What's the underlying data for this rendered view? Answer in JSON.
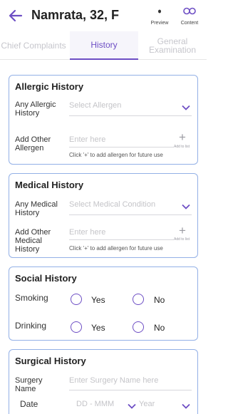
{
  "header": {
    "title": "Namrata, 32, F",
    "preview_label": "Preview",
    "content_label": "Content"
  },
  "tabs": [
    {
      "label": "Chief Complaints",
      "active": false
    },
    {
      "label": "History",
      "active": true
    },
    {
      "label": "General Examination",
      "active": false
    }
  ],
  "allergic_history": {
    "title": "Allergic History",
    "field1_label": "Any Allergic History",
    "field1_placeholder": "Select Allergen",
    "field2_label": "Add Other Allergen",
    "field2_placeholder": "Enter here",
    "add_to_list": "Add to list",
    "hint": "Click '+' to add allergen for future use"
  },
  "medical_history": {
    "title": "Medical History",
    "field1_label": "Any Medical History",
    "field1_placeholder": "Select Medical Condition",
    "field2_label": "Add Other Medical History",
    "field2_placeholder": "Enter here",
    "add_to_list": "Add to list",
    "hint": "Click '+' to add allergen for future use"
  },
  "social_history": {
    "title": "Social History",
    "rows": [
      {
        "label": "Smoking",
        "yes": "Yes",
        "no": "No"
      },
      {
        "label": "Drinking",
        "yes": "Yes",
        "no": "No"
      }
    ]
  },
  "surgical_history": {
    "title": "Surgical History",
    "field1_label": "Surgery Name",
    "field1_placeholder": "Enter Surgery Name here",
    "date_label": "Date",
    "date_placeholder": "DD - MMM",
    "year_placeholder": "Year"
  },
  "colors": {
    "accent": "#6d4ec4",
    "card_border": "#93b0e6"
  }
}
